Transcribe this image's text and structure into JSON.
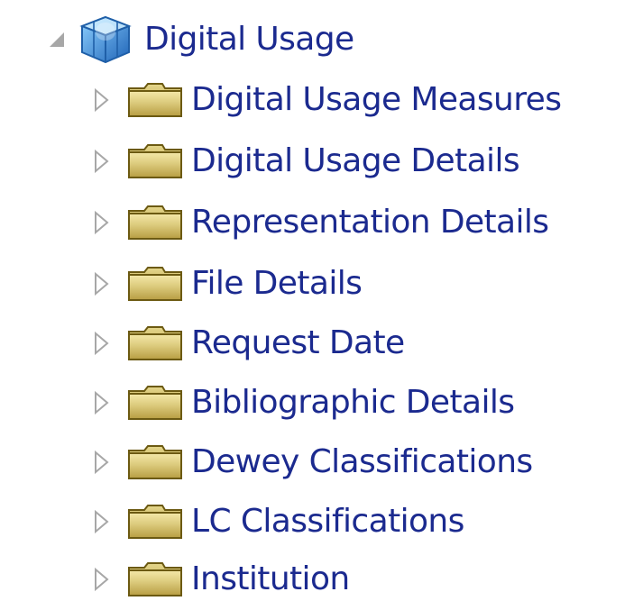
{
  "tree": {
    "root": {
      "label": "Digital Usage",
      "expander_icon": "expanded-triangle-icon",
      "icon": "cube-icon"
    },
    "children": [
      {
        "label": "Digital Usage Measures",
        "icon": "folder-icon",
        "expander_icon": "collapsed-triangle-icon"
      },
      {
        "label": "Digital Usage Details",
        "icon": "folder-icon",
        "expander_icon": "collapsed-triangle-icon"
      },
      {
        "label": "Representation Details",
        "icon": "folder-icon",
        "expander_icon": "collapsed-triangle-icon"
      },
      {
        "label": "File Details",
        "icon": "folder-icon",
        "expander_icon": "collapsed-triangle-icon"
      },
      {
        "label": "Request Date",
        "icon": "folder-icon",
        "expander_icon": "collapsed-triangle-icon"
      },
      {
        "label": "Bibliographic Details",
        "icon": "folder-icon",
        "expander_icon": "collapsed-triangle-icon"
      },
      {
        "label": "Dewey Classifications",
        "icon": "folder-icon",
        "expander_icon": "collapsed-triangle-icon"
      },
      {
        "label": "LC Classifications",
        "icon": "folder-icon",
        "expander_icon": "collapsed-triangle-icon"
      },
      {
        "label": "Institution",
        "icon": "folder-icon",
        "expander_icon": "collapsed-triangle-icon"
      }
    ],
    "colors": {
      "label_text": "#1b2a8f",
      "folder_body": "#d8c77a",
      "folder_outline": "#6c5a12",
      "cube_blue": "#2f7cd1",
      "expander_grey": "#a7a7a7"
    }
  }
}
